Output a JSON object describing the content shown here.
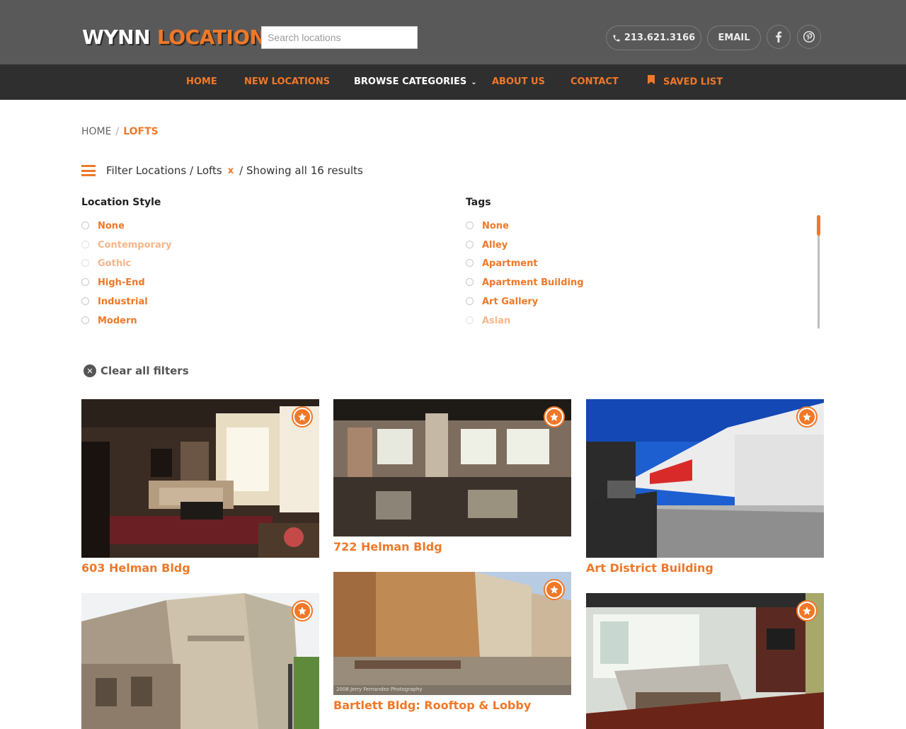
{
  "header": {
    "logo_word1": "WYNN",
    "logo_word2": "LOCATIONS",
    "search_placeholder": "Search locations",
    "phone": "213.621.3166",
    "email_label": "EMAIL",
    "facebook_icon": "facebook-icon",
    "pinterest_icon": "pinterest-icon"
  },
  "nav": {
    "items": [
      {
        "label": "HOME"
      },
      {
        "label": "NEW LOCATIONS"
      },
      {
        "label": "BROWSE CATEGORIES"
      },
      {
        "label": "ABOUT US"
      },
      {
        "label": "CONTACT"
      },
      {
        "label": "SAVED LIST"
      }
    ]
  },
  "breadcrumb": {
    "home": "HOME",
    "separator": "/",
    "current": "LOFTS"
  },
  "filter": {
    "prefix": "Filter Locations / Lofts",
    "remove": "x",
    "results": "/ Showing all 16 results"
  },
  "location_style": {
    "title": "Location Style",
    "options": [
      "None",
      "Contemporary",
      "Gothic",
      "High-End",
      "Industrial",
      "Modern"
    ]
  },
  "tags": {
    "title": "Tags",
    "options": [
      "None",
      "Alley",
      "Apartment",
      "Apartment Building",
      "Art Gallery",
      "Asian"
    ]
  },
  "clear_filters": "Clear all filters",
  "listings": [
    {
      "title": "603 Helman Bldg"
    },
    {
      "title": "722 Helman Bldg"
    },
    {
      "title": "Art District Building"
    },
    {
      "title": "Bartlett Bldg: Rooftop & Lobby"
    },
    {
      "title": ""
    },
    {
      "title": ""
    }
  ],
  "photo_credit": "2008 Jerry Fernandez Photography",
  "colors": {
    "accent": "#f07828",
    "topbar": "#595959",
    "navbar": "#2f2f2f"
  }
}
